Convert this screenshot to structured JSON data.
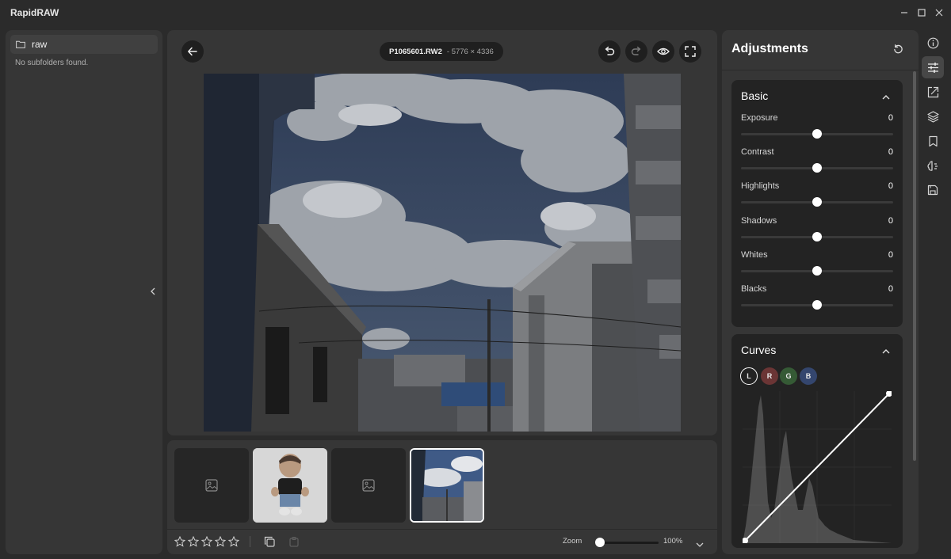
{
  "app": {
    "title": "RapidRAW"
  },
  "sidebar": {
    "folder": "raw",
    "empty_message": "No subfolders found."
  },
  "editor": {
    "file_name": "P1065601.RW2",
    "file_dims": "- 5776 × 4336"
  },
  "filmstrip": {
    "rating_stars": 5,
    "zoom_label": "Zoom",
    "zoom_value": "100%",
    "zoom_level": 0.05
  },
  "adjustments": {
    "title": "Adjustments",
    "basic": {
      "title": "Basic",
      "sliders": [
        {
          "label": "Exposure",
          "value": "0"
        },
        {
          "label": "Contrast",
          "value": "0"
        },
        {
          "label": "Highlights",
          "value": "0"
        },
        {
          "label": "Shadows",
          "value": "0"
        },
        {
          "label": "Whites",
          "value": "0"
        },
        {
          "label": "Blacks",
          "value": "0"
        }
      ]
    },
    "curves": {
      "title": "Curves",
      "channels": [
        {
          "label": "L",
          "color": "#262626"
        },
        {
          "label": "R",
          "color": "#6b3535"
        },
        {
          "label": "G",
          "color": "#355a35"
        },
        {
          "label": "B",
          "color": "#34466e"
        }
      ]
    }
  },
  "colors": {
    "background": "#2b2b2b",
    "panel": "#363636",
    "card": "#232323",
    "accent": "#ffffff"
  }
}
